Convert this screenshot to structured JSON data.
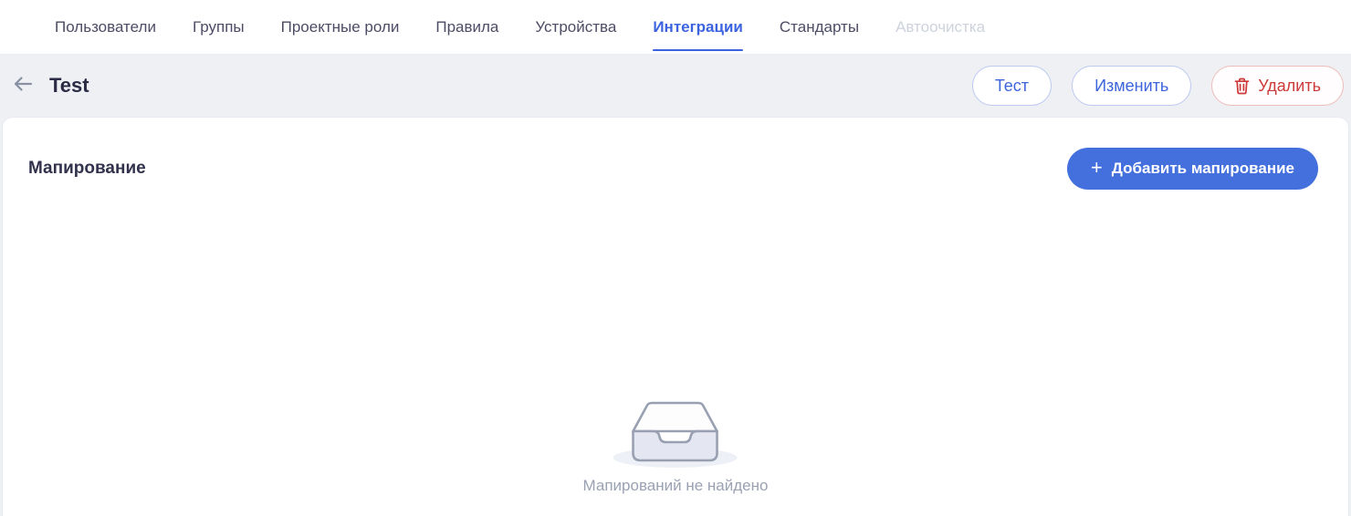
{
  "tabs": {
    "items": [
      {
        "label": "Пользователи",
        "state": "default"
      },
      {
        "label": "Группы",
        "state": "default"
      },
      {
        "label": "Проектные роли",
        "state": "default"
      },
      {
        "label": "Правила",
        "state": "default"
      },
      {
        "label": "Устройства",
        "state": "default"
      },
      {
        "label": "Интеграции",
        "state": "active"
      },
      {
        "label": "Стандарты",
        "state": "default"
      },
      {
        "label": "Автоочистка",
        "state": "disabled"
      }
    ]
  },
  "header": {
    "back_icon": "arrow-left-icon",
    "title": "Test",
    "buttons": {
      "test_label": "Тест",
      "edit_label": "Изменить",
      "delete_label": "Удалить",
      "delete_icon": "trash-icon"
    }
  },
  "main": {
    "section_title": "Мапирование",
    "add_button": {
      "icon": "plus-icon",
      "plus_glyph": "+",
      "label": "Добавить мапирование"
    },
    "empty_state": {
      "icon": "empty-inbox-icon",
      "message": "Мапирований не найдено"
    }
  },
  "colors": {
    "accent_blue": "#3b63e0",
    "add_button_blue": "#4470de",
    "danger_red": "#cd3838",
    "header_bg": "#eef0f4",
    "tab_text": "#4c4c66",
    "tab_disabled": "#cdd2dc",
    "empty_text": "#9aa1b2"
  }
}
